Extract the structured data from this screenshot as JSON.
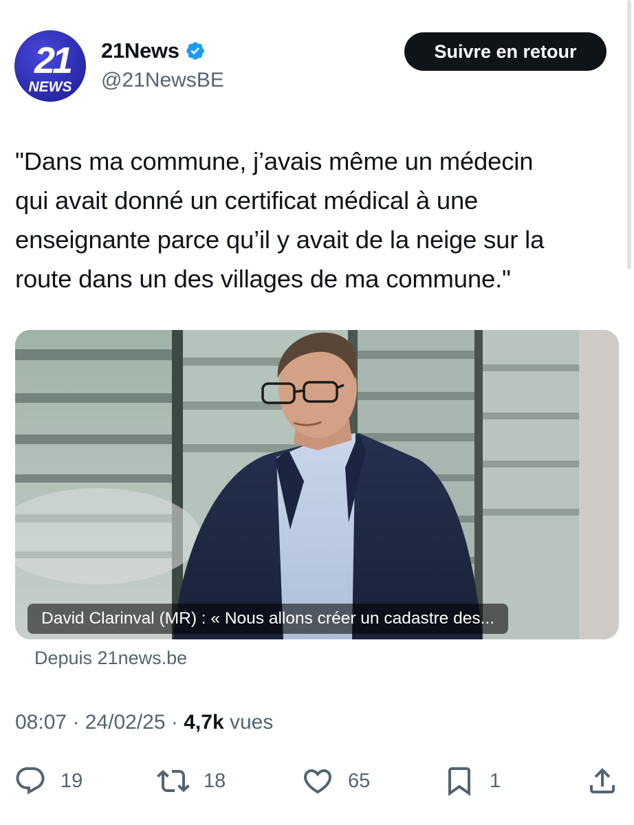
{
  "account": {
    "name": "21News",
    "handle": "@21NewsBE",
    "avatar_text_top": "21",
    "avatar_text_bottom": "NEWS",
    "verified": true
  },
  "follow_button": {
    "label": "Suivre en retour"
  },
  "tweet": {
    "text": "\"Dans ma commune, j’avais même un médecin\nqui avait donné un certificat  médical à une\nenseignante parce qu’il y avait de la neige sur la\nroute  dans un des villages de ma commune.\""
  },
  "card": {
    "caption": "David Clarinval (MR) : « Nous allons créer un cadastre des...",
    "source": "Depuis 21news.be"
  },
  "meta": {
    "time": "08:07",
    "date": "24/02/25",
    "views": "4,7k",
    "views_label": "vues",
    "separator": "·"
  },
  "actions": {
    "replies": "19",
    "reposts": "18",
    "likes": "65",
    "bookmarks": "1"
  },
  "icons": {
    "reply": "reply-icon",
    "repost": "repost-icon",
    "like": "heart-icon",
    "bookmark": "bookmark-icon",
    "share": "share-icon",
    "verified": "verified-badge-icon"
  },
  "colors": {
    "text": "#0f1419",
    "secondary": "#536471",
    "verified": "#1d9bf0",
    "avatar_bg": "#3535c8"
  }
}
